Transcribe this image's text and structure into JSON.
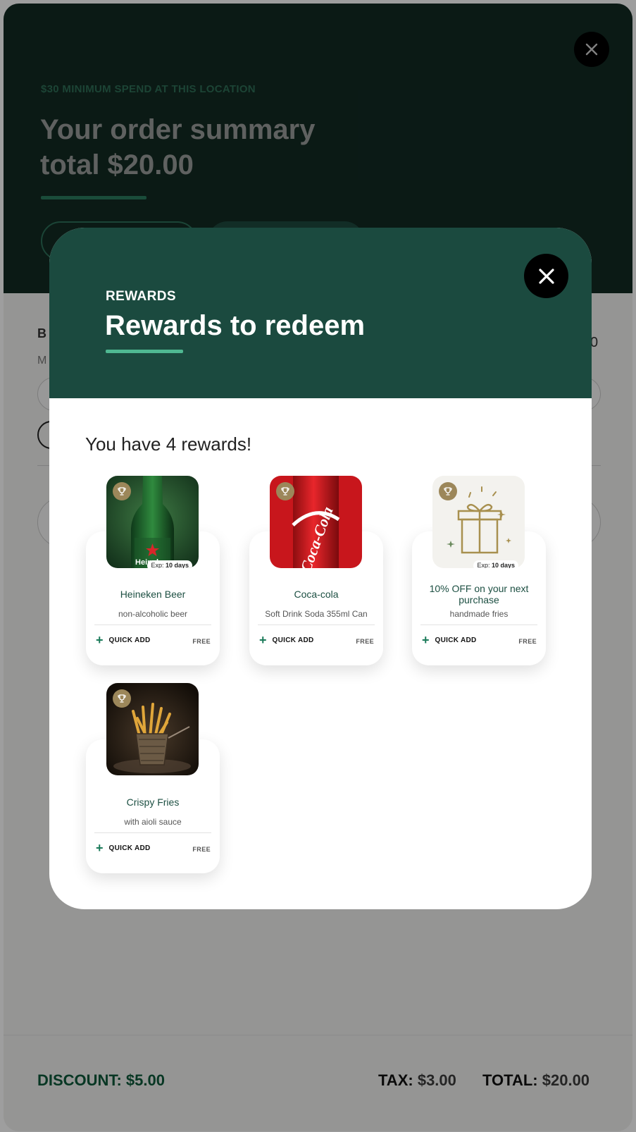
{
  "summary": {
    "eyebrow": "$30 MINIMUM SPEND AT THIS LOCATION",
    "title_line1": "Your order summary",
    "title_line2": "total $20.00",
    "partial_left_label": "B",
    "partial_left_sub": "M",
    "partial_right_value": "0"
  },
  "footer": {
    "discount_label": "DISCOUNT:",
    "discount_value": "$5.00",
    "tax_label": "TAX:",
    "tax_value": "$3.00",
    "total_label": "TOTAL:",
    "total_value": "$20.00"
  },
  "modal": {
    "eyebrow": "REWARDS",
    "title": "Rewards to redeem",
    "count_text": "You have 4 rewards!",
    "quick_add_label": "QUICK ADD",
    "free_label": "FREE",
    "exp_prefix": "Exp:",
    "items": [
      {
        "name": "Heineken Beer",
        "desc": "non-alcoholic beer",
        "exp": "10 days",
        "image": "beer-bottle"
      },
      {
        "name": "Coca-cola",
        "desc": "Soft Drink Soda 355ml Can",
        "exp": "",
        "image": "soda-can"
      },
      {
        "name": "10% OFF on your next purchase",
        "desc": "handmade fries",
        "exp": "10 days",
        "image": "gift-box"
      },
      {
        "name": "Crispy Fries",
        "desc": "with aioli sauce",
        "exp": "",
        "image": "fries-basket"
      }
    ]
  },
  "colors": {
    "header_dark": "#122a23",
    "modal_head": "#1b4a3f",
    "accent_green": "#4fb892",
    "discount_green": "#0d5a3a",
    "trophy_badge": "#9c875a"
  }
}
